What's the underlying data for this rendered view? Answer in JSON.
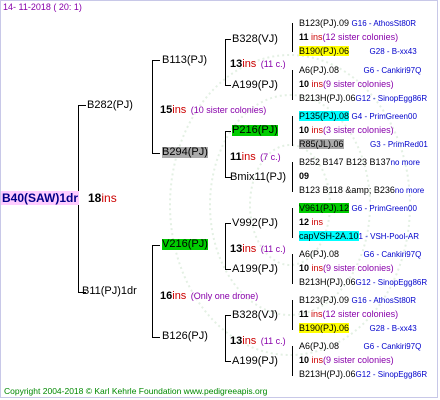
{
  "header": "14- 11-2018 ( 20: 1)",
  "footer": "Copyright 2004-2018 © Karl Kehrle Foundation www.pedigreeapis.org",
  "root": {
    "name": "B40(SAW)1dr",
    "num": "18",
    "ins": "ins"
  },
  "gen1": [
    {
      "name": "B282(PJ)",
      "num": "15",
      "ins": "ins",
      "note": "(10 sister colonies)"
    },
    {
      "name": "B11(PJ)1dr",
      "num": "16",
      "ins": "ins",
      "note": "(Only one drone)"
    }
  ],
  "gen2": [
    {
      "name": "B113(PJ)",
      "num": "13",
      "ins": "ins",
      "note": "(11 c.)"
    },
    {
      "name": "B294(PJ)",
      "num": "11",
      "ins": "ins",
      "note": "(7 c.)"
    },
    {
      "name": "V216(PJ)",
      "num": "13",
      "ins": "ins",
      "note": "(11 c.)"
    },
    {
      "name": "B126(PJ)",
      "num": "13",
      "ins": "ins",
      "note": "(11 c.)"
    }
  ],
  "gen3": [
    {
      "name": "B328(VJ)"
    },
    {
      "name": "A199(PJ)"
    },
    {
      "name": "P216(PJ)"
    },
    {
      "name": "Bmix11(PJ)"
    },
    {
      "name": "V992(PJ)"
    },
    {
      "name": "A199(PJ)"
    },
    {
      "name": "B328(VJ)"
    },
    {
      "name": "A199(PJ)"
    }
  ],
  "gen4": [
    {
      "name": "B123(PJ).09",
      "lin": "G16 - AthosSt80R"
    },
    {
      "num": "11",
      "ins": "ins",
      "note": "(12 sister colonies)"
    },
    {
      "name": "B190(PJ).06",
      "lin": "G28 - B-xx43"
    },
    {
      "name": "A6(PJ).08",
      "lin": "G6 - Cankiri97Q"
    },
    {
      "num": "10",
      "ins": "ins",
      "note": "(9 sister colonies)"
    },
    {
      "name": "B213H(PJ).06",
      "lin": "G12 - SinopEgg86R"
    },
    {
      "name": "P135(PJ).08",
      "lin": "G4 - PrimGreen00"
    },
    {
      "num": "10",
      "ins": "ins",
      "note": "(3 sister colonies)"
    },
    {
      "name": "R85(JL).06",
      "lin": "G3 - PrimRed01"
    },
    {
      "text": "B252 B147 B123 B137",
      "more": "no more"
    },
    {
      "num": "09"
    },
    {
      "text": "B123 B118 &amp; B236",
      "more": "no more"
    },
    {
      "name": "V961(PJ).12",
      "lin": "G6 - PrimGreen00"
    },
    {
      "num": "12",
      "ins": "ins"
    },
    {
      "name": "capVSH-2A.10",
      "lin": "1 - VSH-Pool-AR"
    },
    {
      "name": "A6(PJ).08",
      "lin": "G6 - Cankiri97Q"
    },
    {
      "num": "10",
      "ins": "ins",
      "note": "(9 sister colonies)"
    },
    {
      "name": "B213H(PJ).06",
      "lin": "G12 - SinopEgg86R"
    },
    {
      "name": "B123(PJ).09",
      "lin": "G16 - AthosSt80R"
    },
    {
      "num": "11",
      "ins": "ins",
      "note": "(12 sister colonies)"
    },
    {
      "name": "B190(PJ).06",
      "lin": "G28 - B-xx43"
    },
    {
      "name": "A6(PJ).08",
      "lin": "G6 - Cankiri97Q"
    },
    {
      "num": "10",
      "ins": "ins",
      "note": "(9 sister colonies)"
    },
    {
      "name": "B213H(PJ).06",
      "lin": "G12 - SinopEgg86R"
    }
  ]
}
